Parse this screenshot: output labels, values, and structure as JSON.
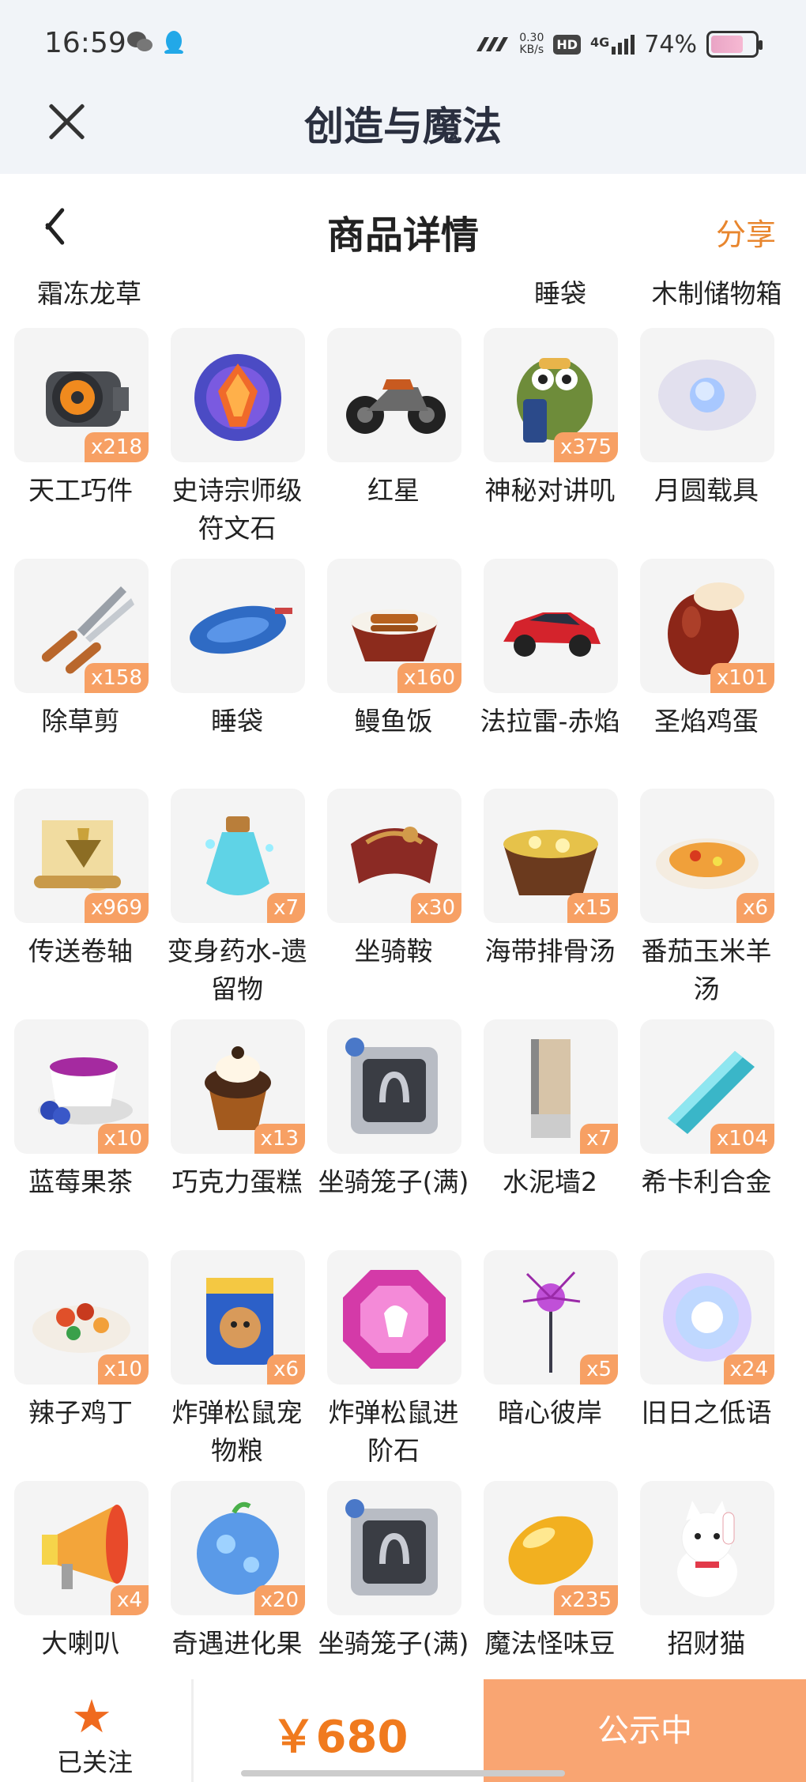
{
  "status_bar": {
    "time": "16:59",
    "net_speed_value": "0.30",
    "net_speed_unit": "KB/s",
    "hd_label": "HD",
    "network": "4G",
    "battery_percent": "74%",
    "battery_level": 0.74,
    "icons": [
      "wechat-icon",
      "qq-icon",
      "signal-icon",
      "battery-icon"
    ]
  },
  "app_header": {
    "title": "创造与魔法"
  },
  "page_header": {
    "title": "商品详情",
    "share_label": "分享"
  },
  "partial_row": [
    "霜冻龙草",
    "睡袋",
    "木制储物箱"
  ],
  "items": [
    {
      "name": "天工巧件",
      "count": "x218",
      "icon": "gear-part-icon"
    },
    {
      "name": "史诗宗师级符文石",
      "count": "",
      "icon": "rune-stone-icon"
    },
    {
      "name": "红星",
      "count": "",
      "icon": "motorcycle-icon"
    },
    {
      "name": "神秘对讲叽",
      "count": "x375",
      "icon": "walkie-bird-icon"
    },
    {
      "name": "月圆载具",
      "count": "",
      "icon": "moon-orb-icon"
    },
    {
      "name": "除草剪",
      "count": "x158",
      "icon": "shears-icon"
    },
    {
      "name": "睡袋",
      "count": "",
      "icon": "sleeping-bag-icon"
    },
    {
      "name": "鳗鱼饭",
      "count": "x160",
      "icon": "eel-rice-icon"
    },
    {
      "name": "法拉雷-赤焰",
      "count": "",
      "icon": "red-car-icon"
    },
    {
      "name": "圣焰鸡蛋",
      "count": "x101",
      "icon": "egg-icon"
    },
    {
      "name": "传送卷轴",
      "count": "x969",
      "icon": "scroll-icon"
    },
    {
      "name": "变身药水-遗留物",
      "count": "x7",
      "icon": "potion-icon"
    },
    {
      "name": "坐骑鞍",
      "count": "x30",
      "icon": "saddle-icon"
    },
    {
      "name": "海带排骨汤",
      "count": "x15",
      "icon": "soup-bowl-icon"
    },
    {
      "name": "番茄玉米羊汤",
      "count": "x6",
      "icon": "soup-plate-icon"
    },
    {
      "name": "蓝莓果茶",
      "count": "x10",
      "icon": "berry-tea-icon"
    },
    {
      "name": "巧克力蛋糕",
      "count": "x13",
      "icon": "cupcake-icon"
    },
    {
      "name": "坐骑笼子(满)",
      "count": "",
      "icon": "mount-cage-icon"
    },
    {
      "name": "水泥墙2",
      "count": "x7",
      "icon": "cement-wall-icon"
    },
    {
      "name": "希卡利合金",
      "count": "x104",
      "icon": "alloy-bar-icon"
    },
    {
      "name": "辣子鸡丁",
      "count": "x10",
      "icon": "spicy-chicken-icon"
    },
    {
      "name": "炸弹松鼠宠物粮",
      "count": "x6",
      "icon": "pet-food-bag-icon"
    },
    {
      "name": "炸弹松鼠进阶石",
      "count": "",
      "icon": "advance-gem-icon"
    },
    {
      "name": "暗心彼岸",
      "count": "x5",
      "icon": "spider-lily-icon"
    },
    {
      "name": "旧日之低语",
      "count": "x24",
      "icon": "glow-orb-icon"
    },
    {
      "name": "大喇叭",
      "count": "x4",
      "icon": "megaphone-icon"
    },
    {
      "name": "奇遇进化果",
      "count": "x20",
      "icon": "evolution-fruit-icon"
    },
    {
      "name": "坐骑笼子(满)",
      "count": "",
      "icon": "mount-cage-icon"
    },
    {
      "name": "魔法怪味豆",
      "count": "x235",
      "icon": "magic-bean-icon"
    },
    {
      "name": "招财猫",
      "count": "",
      "icon": "lucky-cat-icon"
    }
  ],
  "bottom_bar": {
    "follow_label": "已关注",
    "price": "￥680",
    "cta_label": "公示中"
  },
  "colors": {
    "accent": "#f07a1e",
    "badge": "#f7a064",
    "cta": "#f9a572"
  }
}
